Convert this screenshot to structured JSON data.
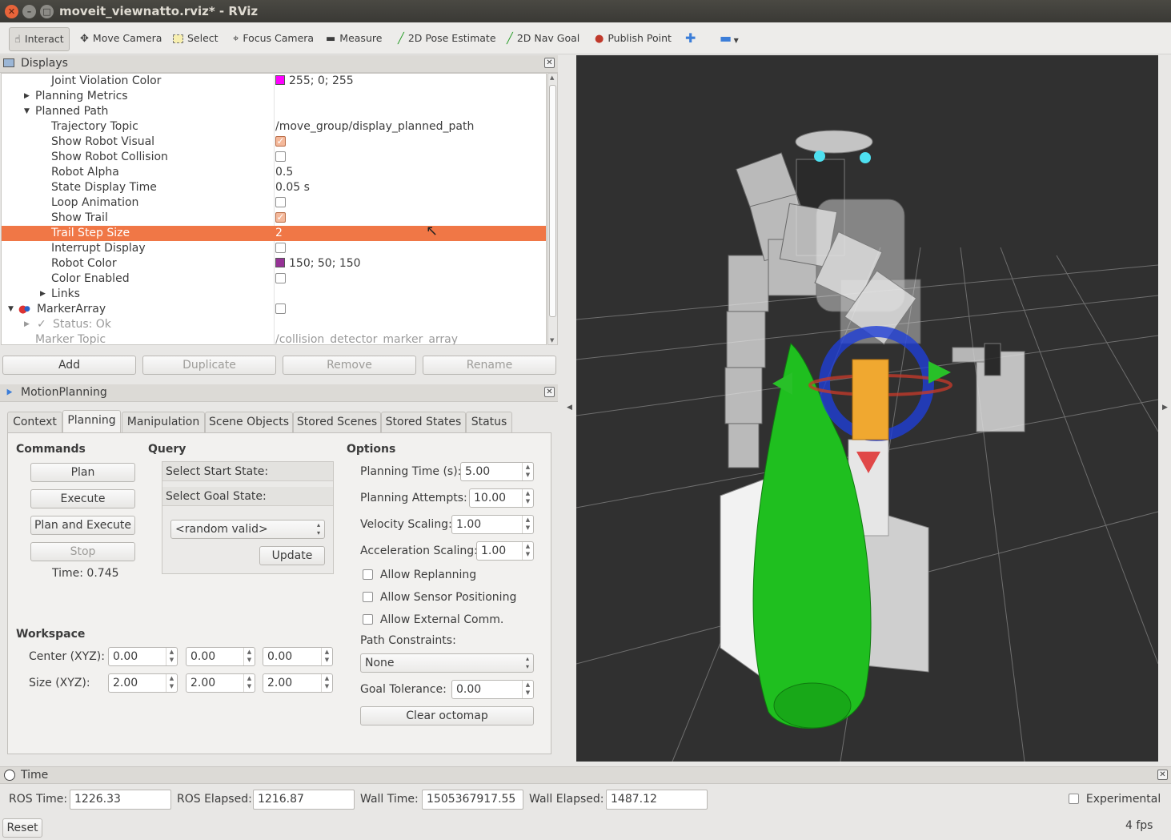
{
  "window": {
    "title": "moveit_viewnatto.rviz* - RViz"
  },
  "toolbar": {
    "interact": "Interact",
    "move_camera": "Move Camera",
    "select": "Select",
    "focus_camera": "Focus Camera",
    "measure": "Measure",
    "pose_estimate": "2D Pose Estimate",
    "nav_goal": "2D Nav Goal",
    "publish_point": "Publish Point"
  },
  "displays": {
    "title": "Displays",
    "rows": [
      {
        "name": "Joint Violation Color",
        "value": "255; 0; 255",
        "color": "#ff00ff"
      },
      {
        "name": "Planning Metrics",
        "value": ""
      },
      {
        "name": "Planned Path",
        "value": ""
      },
      {
        "name": "Trajectory Topic",
        "value": "/move_group/display_planned_path"
      },
      {
        "name": "Show Robot Visual",
        "checked": true
      },
      {
        "name": "Show Robot Collision",
        "checked": false
      },
      {
        "name": "Robot Alpha",
        "value": "0.5"
      },
      {
        "name": "State Display Time",
        "value": "0.05 s"
      },
      {
        "name": "Loop Animation",
        "checked": false
      },
      {
        "name": "Show Trail",
        "checked": true
      },
      {
        "name": "Trail Step Size",
        "value": "2"
      },
      {
        "name": "Interrupt Display",
        "checked": false
      },
      {
        "name": "Robot Color",
        "value": "150; 50; 150",
        "color": "#963296"
      },
      {
        "name": "Color Enabled",
        "checked": false
      },
      {
        "name": "Links",
        "value": ""
      },
      {
        "name": "MarkerArray",
        "checked": false
      },
      {
        "name": "Status: Ok",
        "value": ""
      },
      {
        "name": "Marker Topic",
        "value": "/collision_detector_marker_array"
      }
    ],
    "buttons": {
      "add": "Add",
      "duplicate": "Duplicate",
      "remove": "Remove",
      "rename": "Rename"
    }
  },
  "motion": {
    "title": "MotionPlanning",
    "tabs": [
      "Context",
      "Planning",
      "Manipulation",
      "Scene Objects",
      "Stored Scenes",
      "Stored States",
      "Status"
    ],
    "commands": {
      "title": "Commands",
      "plan": "Plan",
      "execute": "Execute",
      "plan_execute": "Plan and Execute",
      "stop": "Stop",
      "time": "Time: 0.745"
    },
    "query": {
      "title": "Query",
      "start": "Select Start State:",
      "goal": "Select Goal State:",
      "goal_value": "<random valid>",
      "update": "Update"
    },
    "options": {
      "title": "Options",
      "planning_time_label": "Planning Time (s):",
      "planning_time": "5.00",
      "attempts_label": "Planning Attempts:",
      "attempts": "10.00",
      "velocity_label": "Velocity Scaling:",
      "velocity": "1.00",
      "accel_label": "Acceleration Scaling:",
      "accel": "1.00",
      "allow_replanning": "Allow Replanning",
      "allow_sensor": "Allow Sensor Positioning",
      "allow_external": "Allow External Comm.",
      "path_constraints_label": "Path Constraints:",
      "path_constraints": "None",
      "goal_tol_label": "Goal Tolerance:",
      "goal_tol": "0.00",
      "clear_octomap": "Clear octomap"
    },
    "workspace": {
      "title": "Workspace",
      "center_label": "Center (XYZ):",
      "size_label": "Size (XYZ):",
      "center": [
        "0.00",
        "0.00",
        "0.00"
      ],
      "size": [
        "2.00",
        "2.00",
        "2.00"
      ]
    }
  },
  "time": {
    "title": "Time",
    "ros_time_label": "ROS Time:",
    "ros_time": "1226.33",
    "ros_elapsed_label": "ROS Elapsed:",
    "ros_elapsed": "1216.87",
    "wall_time_label": "Wall Time:",
    "wall_time": "1505367917.55",
    "wall_elapsed_label": "Wall Elapsed:",
    "wall_elapsed": "1487.12",
    "experimental": "Experimental"
  },
  "status": {
    "reset": "Reset",
    "fps": "4 fps"
  }
}
